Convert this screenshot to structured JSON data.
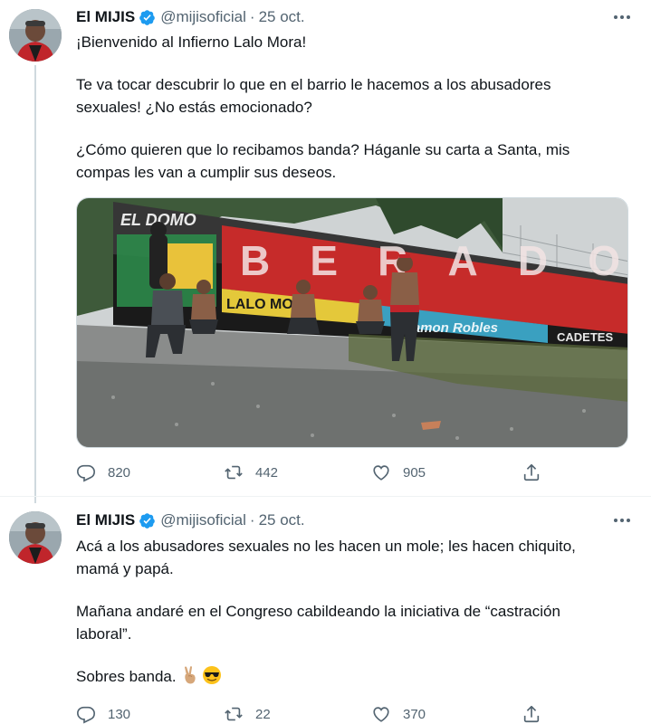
{
  "tweets": [
    {
      "author_name": "El MIJIS",
      "handle": "@mijisoficial",
      "separator": "·",
      "date": "25 oct.",
      "paragraphs": [
        "¡Bienvenido al Infierno Lalo Mora!",
        "Te va tocar descubrir lo que en el barrio le hacemos a los abusadores sexuales! ¿No estás emocionado?",
        "¿Cómo quieren que lo recibamos banda? Háganle su carta a Santa, mis compas les van a cumplir sus deseos."
      ],
      "media": {
        "mural_texts": [
          "EL DOMO",
          "LALO MORA",
          "BERADO",
          "Ramon Robles",
          "CADETES"
        ]
      },
      "replies": "820",
      "retweets": "442",
      "likes": "905"
    },
    {
      "author_name": "El MIJIS",
      "handle": "@mijisoficial",
      "separator": "·",
      "date": "25 oct.",
      "paragraphs": [
        "Acá a los abusadores sexuales no les hacen un mole; les hacen chiquito, mamá y papá.",
        "Mañana andaré en el Congreso cabildeando la iniciativa de “castración laboral”.",
        "Sobres banda."
      ],
      "emojis": [
        "victory-hand",
        "smiling-face-with-sunglasses"
      ],
      "replies": "130",
      "retweets": "22",
      "likes": "370"
    }
  ],
  "colors": {
    "text": "#0f1419",
    "secondary": "#536471",
    "verified": "#1d9bf0",
    "thread_line": "#cfd9de"
  },
  "icons": [
    "verified-badge-icon",
    "more-options-icon",
    "reply-icon",
    "retweet-icon",
    "like-icon",
    "share-icon"
  ]
}
